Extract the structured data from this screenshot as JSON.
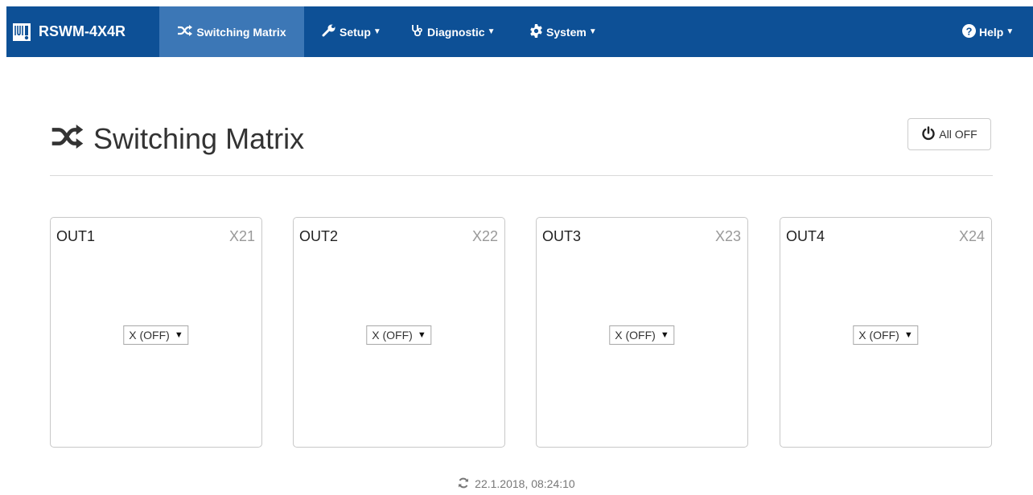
{
  "navbar": {
    "brand": "RSWM-4X4R",
    "items": [
      {
        "label": "Switching Matrix",
        "icon": "shuffle-icon",
        "active": true
      },
      {
        "label": "Setup",
        "icon": "wrench-icon",
        "dropdown": true
      },
      {
        "label": "Diagnostic",
        "icon": "stethoscope-icon",
        "dropdown": true
      },
      {
        "label": "System",
        "icon": "gear-icon",
        "dropdown": true
      }
    ],
    "help": {
      "label": "Help",
      "icon": "question-circle-icon",
      "dropdown": true
    },
    "colors": {
      "background": "#0d5096",
      "active": "#3c77b6",
      "text": "#ffffff"
    }
  },
  "page": {
    "title": "Switching Matrix",
    "title_icon": "shuffle-icon",
    "all_off_label": "All OFF",
    "all_off_icon": "power-icon"
  },
  "outputs": [
    {
      "label": "OUT1",
      "connector": "X21",
      "selection": "X (OFF)"
    },
    {
      "label": "OUT2",
      "connector": "X22",
      "selection": "X (OFF)"
    },
    {
      "label": "OUT3",
      "connector": "X23",
      "selection": "X (OFF)"
    },
    {
      "label": "OUT4",
      "connector": "X24",
      "selection": "X (OFF)"
    }
  ],
  "footer": {
    "timestamp": "22.1.2018, 08:24:10",
    "icon": "refresh-icon"
  }
}
